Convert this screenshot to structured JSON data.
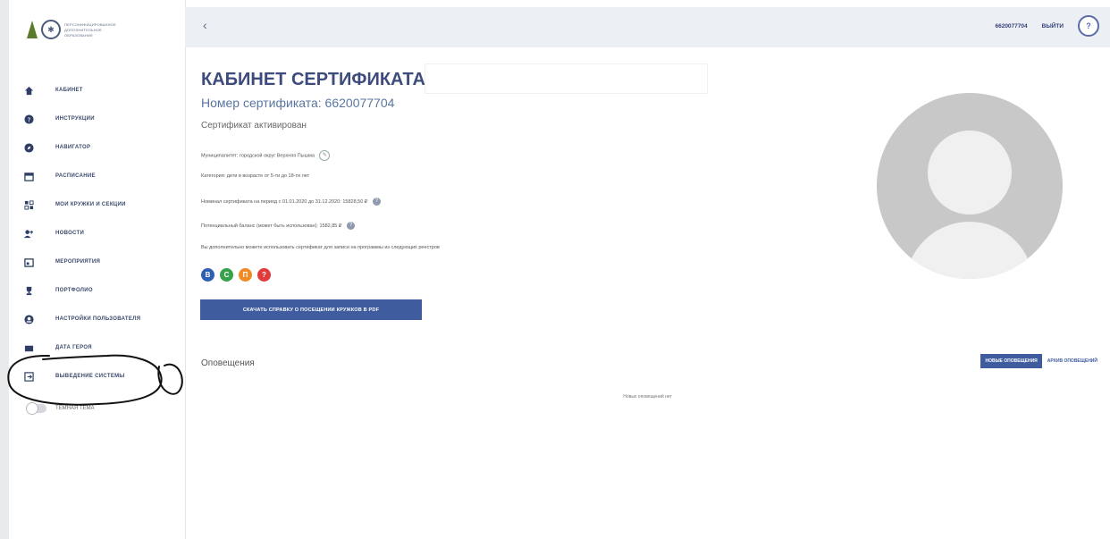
{
  "sidebar": {
    "logo_lines": [
      "ПЕРСОНИФИЦИРОВАННОЕ",
      "ДОПОЛНИТЕЛЬНОЕ",
      "ОБРАЗОВАНИЕ"
    ],
    "items": [
      {
        "label": "КАБИНЕТ",
        "icon": "home-icon"
      },
      {
        "label": "ИНСТРУКЦИИ",
        "icon": "question-icon"
      },
      {
        "label": "НАВИГАТОР",
        "icon": "compass-icon"
      },
      {
        "label": "РАСПИСАНИЕ",
        "icon": "calendar-icon"
      },
      {
        "label": "МОИ КРУЖКИ И СЕКЦИИ",
        "icon": "groups-icon"
      },
      {
        "label": "НОВОСТИ",
        "icon": "news-icon"
      },
      {
        "label": "МЕРОПРИЯТИЯ",
        "icon": "events-icon"
      },
      {
        "label": "ПОРТФОЛИО",
        "icon": "trophy-icon"
      },
      {
        "label": "НАСТРОЙКИ ПОЛЬЗОВАТЕЛЯ",
        "icon": "user-settings-icon"
      },
      {
        "label": "ДАТА ГЕРОЯ",
        "icon": "hero-icon"
      },
      {
        "label": "ВЫВЕДЕНИЕ СИСТЕМЫ",
        "icon": "exit-system-icon"
      }
    ],
    "toggle_label": "ТЁМНАЯ ТЕМА"
  },
  "topbar": {
    "back": "‹",
    "account_number": "6620077704",
    "logout": "ВЫЙТИ",
    "help": "?"
  },
  "main": {
    "title": "КАБИНЕТ СЕРТИФИКАТА:",
    "cert_number": "Номер сертификата: 6620077704",
    "cert_status": "Сертификат активирован",
    "municipality": "Муниципалитет: городской округ Верхняя Пышма",
    "category": "Категория: дети в возрасте от 5-ти до 18-ти лет",
    "nominal": "Номинал сертификата на период с 01.01.2020 до 31.12.2020: 15828,50 ₽",
    "balance": "Потенциальный баланс (может быть использован): 1582,85 ₽",
    "registries_note": "Вы дополнительно можете использовать сертификат для записи на программы из следующих реестров",
    "registry_dots": [
      {
        "label": "В",
        "color": "#2f5fb3"
      },
      {
        "label": "С",
        "color": "#36a34a"
      },
      {
        "label": "П",
        "color": "#f08a24"
      },
      {
        "label": "?",
        "color": "#e23b3b"
      }
    ],
    "pdf_button": "СКАЧАТЬ СПРАВКУ О ПОСЕЩЕНИИ КРУЖКОВ В PDF",
    "notifications_title": "Оповещения",
    "tab_new": "НОВЫЕ ОПОВЕЩЕНИЯ",
    "tab_archive": "АРХИВ ОПОВЕЩЕНИЙ",
    "no_notifications": "Новых оповещений нет"
  }
}
